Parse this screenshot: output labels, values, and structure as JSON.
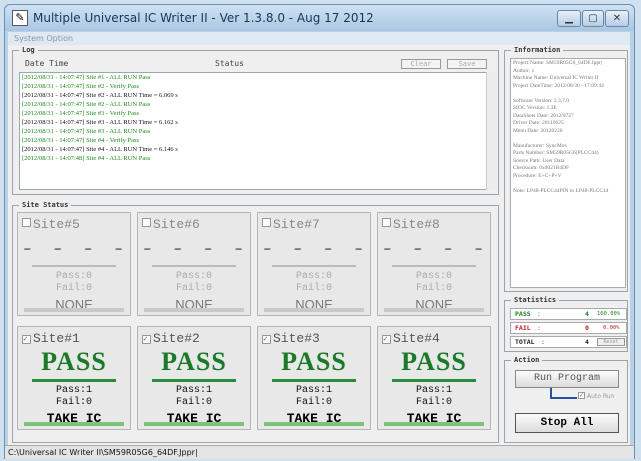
{
  "window": {
    "title": "Multiple Universal IC Writer II - Ver 1.3.8.0 - Aug 17 2012",
    "min_icon": "minimize-icon",
    "max_icon": "maximize-icon",
    "close_icon": "close-icon"
  },
  "menu": {
    "text": "System Option"
  },
  "log": {
    "title": "Log",
    "col_datetime": "Date Time",
    "col_status": "Status",
    "clear_label": "Clear",
    "save_label": "Save",
    "lines": [
      {
        "text": "[2012/08/31 - 14:07:47] Site #1 - ALL RUN Pass",
        "color": "g"
      },
      {
        "text": "[2012/08/31 - 14:07:47] Site #2 - Verify Pass",
        "color": "g"
      },
      {
        "text": "[2012/08/31 - 14:07:47] Site #2 - ALL RUN Time = 6.069 s",
        "color": "k"
      },
      {
        "text": "[2012/08/31 - 14:07:47] Site #2 - ALL RUN Pass",
        "color": "g"
      },
      {
        "text": "[2012/08/31 - 14:07:47] Site #3 - Verify Pass",
        "color": "g"
      },
      {
        "text": "[2012/08/31 - 14:07:47] Site #3 - ALL RUN Time = 6.162 s",
        "color": "k"
      },
      {
        "text": "[2012/08/31 - 14:07:47] Site #3 - ALL RUN Pass",
        "color": "g"
      },
      {
        "text": "[2012/08/31 - 14:07:47] Site #4 - Verify Pass",
        "color": "g"
      },
      {
        "text": "[2012/08/31 - 14:07:47] Site #4 - ALL RUN Time = 6.146 s",
        "color": "k"
      },
      {
        "text": "[2012/08/31 - 14:07:48] Site #4 - ALL RUN Pass",
        "color": "g"
      }
    ]
  },
  "site_status": {
    "title": "Site Status",
    "sites": [
      {
        "name": "Site#5",
        "checked": false,
        "result": "- - - -",
        "pass": "Pass:0",
        "fail": "Fail:0",
        "action": "NONE"
      },
      {
        "name": "Site#6",
        "checked": false,
        "result": "- - - -",
        "pass": "Pass:0",
        "fail": "Fail:0",
        "action": "NONE"
      },
      {
        "name": "Site#7",
        "checked": false,
        "result": "- - - -",
        "pass": "Pass:0",
        "fail": "Fail:0",
        "action": "NONE"
      },
      {
        "name": "Site#8",
        "checked": false,
        "result": "- - - -",
        "pass": "Pass:0",
        "fail": "Fail:0",
        "action": "NONE"
      },
      {
        "name": "Site#1",
        "checked": true,
        "result": "PASS",
        "pass": "Pass:1",
        "fail": "Fail:0",
        "action": "TAKE IC"
      },
      {
        "name": "Site#2",
        "checked": true,
        "result": "PASS",
        "pass": "Pass:1",
        "fail": "Fail:0",
        "action": "TAKE IC"
      },
      {
        "name": "Site#3",
        "checked": true,
        "result": "PASS",
        "pass": "Pass:1",
        "fail": "Fail:0",
        "action": "TAKE IC"
      },
      {
        "name": "Site#4",
        "checked": true,
        "result": "PASS",
        "pass": "Pass:1",
        "fail": "Fail:0",
        "action": "TAKE IC"
      }
    ]
  },
  "information": {
    "title": "Information",
    "lines": [
      "Project Name: SM59R05G6_64DF.Jppr|",
      "Author: 1",
      "Machine Name: Universal IC Writer II",
      "Project DateTime: 2012/08/30 - 17:09:44",
      "",
      "Software Version: 2.3.7.0",
      "SIOC Version: 1.3E",
      "DataSheet Date: 2012/0727",
      "Driver Date: 20110625",
      "Menu Date: 20120220",
      "",
      "Manufacturer: SyncMos",
      "Parts Number: SM59R05G6(PLCC44)",
      "Source Path: User Data",
      "Checksum: 0x0021B4DF",
      "Procedure: E+C+P+V",
      "",
      "Note: LP48-PLCC44PIN to LP48-PLCC44"
    ]
  },
  "statistics": {
    "title": "Statistics",
    "pass_label": "PASS",
    "pass_count": "4",
    "pass_pct": "100.00%",
    "fail_label": "FAIL",
    "fail_count": "0",
    "fail_pct": "0.00%",
    "total_label": "TOTAL",
    "total_count": "4",
    "reset_label": "Reset"
  },
  "action": {
    "title": "Action",
    "run_label": "Run Program",
    "auto_run_label": "Auto Run",
    "stop_label": "Stop All"
  },
  "statusbar": {
    "path": "C:\\Universal IC Writer II\\SM59R05G6_64DF.Jppr|"
  }
}
